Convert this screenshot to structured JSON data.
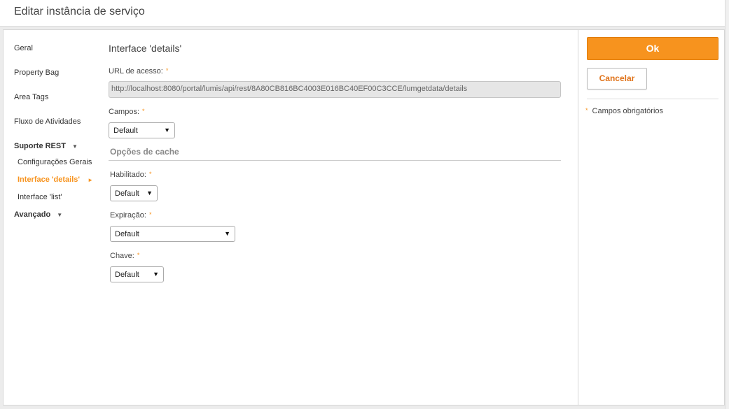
{
  "window": {
    "title": "Editar instância de serviço"
  },
  "nav": {
    "items": [
      {
        "label": "Geral"
      },
      {
        "label": "Property Bag"
      },
      {
        "label": "Area Tags"
      },
      {
        "label": "Fluxo de Atividades"
      },
      {
        "label": "Suporte REST"
      },
      {
        "label": "Configurações Gerais"
      },
      {
        "label": "Interface 'details'"
      },
      {
        "label": "Interface 'list'"
      },
      {
        "label": "Avançado"
      }
    ],
    "caret_icon": "▼",
    "active_arrow_icon": "►"
  },
  "form": {
    "title": "Interface 'details'",
    "url_label": "URL de acesso:",
    "url_value": "http://localhost:8080/portal/lumis/api/rest/8A80CB816BC4003E016BC40EF00C3CCE/lumgetdata/details",
    "campos_label": "Campos:",
    "campos_value": "Default",
    "cache_section": "Opções de cache",
    "habilitado_label": "Habilitado:",
    "habilitado_value": "Default",
    "expiracao_label": "Expiração:",
    "expiracao_value": "Default",
    "chave_label": "Chave:",
    "chave_value": "Default",
    "required_mark": "*",
    "dropdown_icon": "▼"
  },
  "actions": {
    "ok_label": "Ok",
    "cancel_label": "Cancelar",
    "legend_mark": "*",
    "legend_label": "Campos obrigatórios"
  },
  "colors": {
    "accent": "#f7931e",
    "cancel_text": "#e0731a"
  }
}
